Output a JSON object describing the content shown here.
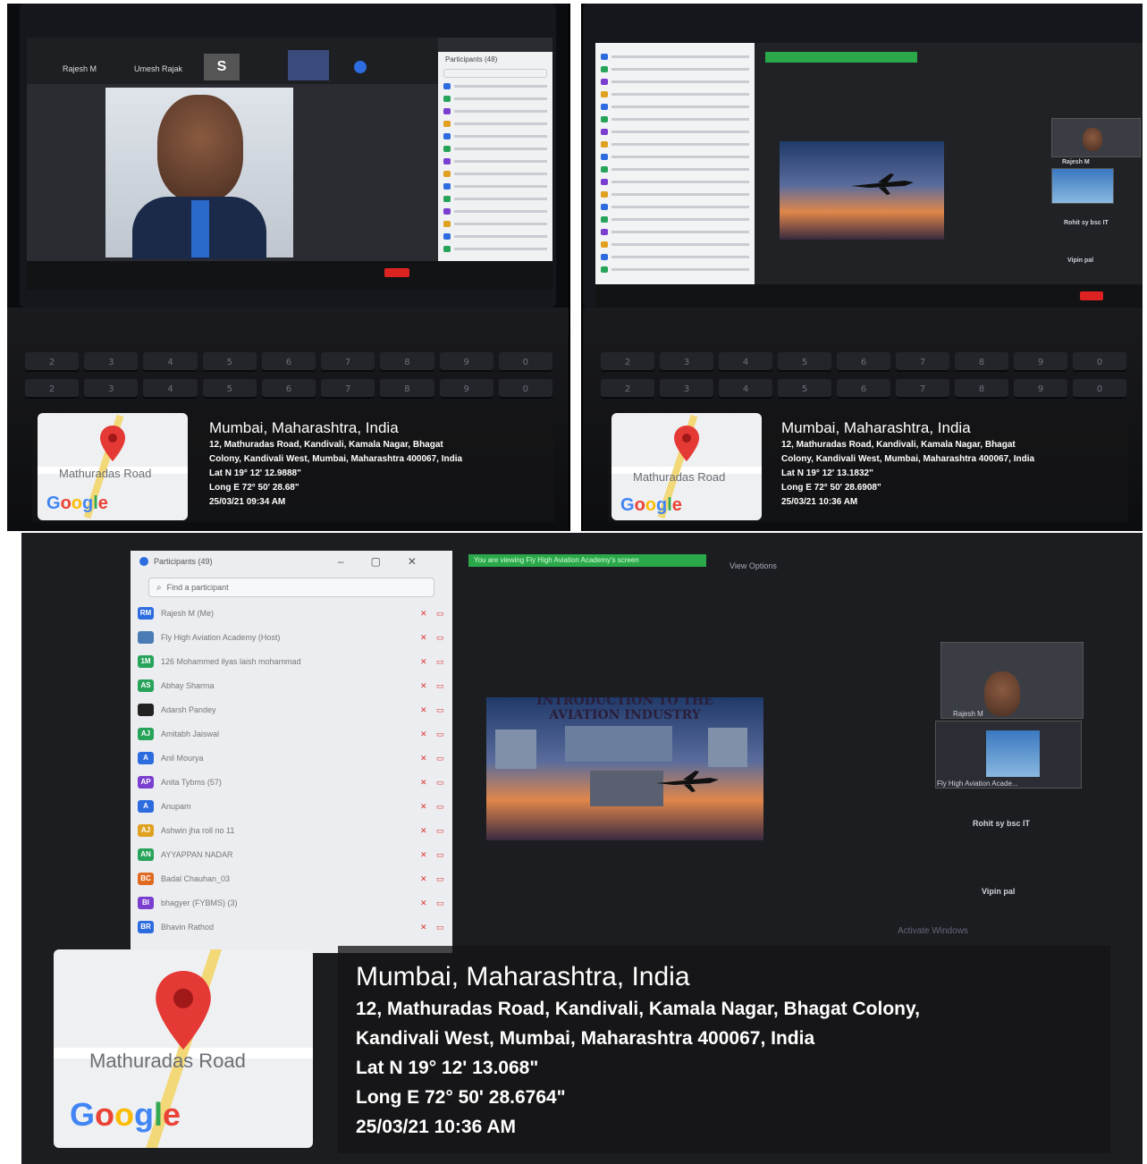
{
  "photos": [
    {
      "zoom": {
        "top_names": [
          "Rajesh M",
          "Umesh Rajak",
          "S"
        ],
        "participants_title": "Participants (48)"
      },
      "stamp": {
        "city": "Mumbai, Maharashtra, India",
        "address_line1": "12, Mathuradas Road, Kandivali, Kamala Nagar, Bhagat",
        "address_line2": "Colony, Kandivali West, Mumbai, Maharashtra 400067, India",
        "lat": "Lat N 19° 12' 12.9888\"",
        "long": "Long E 72° 50' 28.68\"",
        "datetime": "25/03/21 09:34 AM",
        "map_label": "Mathuradas Road",
        "logo": "Google"
      }
    },
    {
      "zoom": {
        "thumb_names": [
          "Rajesh M",
          "Rohit sy bsc IT",
          "Vipin pal"
        ]
      },
      "stamp": {
        "city": "Mumbai, Maharashtra, India",
        "address_line1": "12, Mathuradas Road, Kandivali, Kamala Nagar, Bhagat",
        "address_line2": "Colony, Kandivali West, Mumbai, Maharashtra 400067, India",
        "lat": "Lat N 19° 12' 13.1832\"",
        "long": "Long E 72° 50' 28.6908\"",
        "datetime": "25/03/21 10:36 AM",
        "map_label": "Mathuradas Road",
        "logo": "Google"
      }
    },
    {
      "zoom": {
        "participants_title": "Participants (49)",
        "search_placeholder": "Find a participant",
        "view_options": "View Options",
        "sharing_banner": "You are viewing Fly High Aviation Academy's screen",
        "slide_title_1": "INTRODUCTION TO THE",
        "slide_title_2": "AVIATION INDUSTRY",
        "participants": [
          {
            "initials": "RM",
            "name": "Rajesh M (Me)",
            "color": "#2d6cdf"
          },
          {
            "initials": "",
            "name": "Fly High Aviation Academy (Host)",
            "color": "#4a7bb5"
          },
          {
            "initials": "1M",
            "name": "126 Mohammed ilyas laish mohammad",
            "color": "#27a35a"
          },
          {
            "initials": "AS",
            "name": "Abhay Sharma",
            "color": "#27a35a"
          },
          {
            "initials": "",
            "name": "Adarsh Pandey",
            "color": "#222222"
          },
          {
            "initials": "AJ",
            "name": "Amitabh Jaiswal",
            "color": "#27a35a"
          },
          {
            "initials": "A",
            "name": "Anil Mourya",
            "color": "#2d6cdf"
          },
          {
            "initials": "AP",
            "name": "Anita Tybms (57)",
            "color": "#7b3fd0"
          },
          {
            "initials": "A",
            "name": "Anupam",
            "color": "#2d6cdf"
          },
          {
            "initials": "AJ",
            "name": "Ashwin jha roll no 11",
            "color": "#e0a020"
          },
          {
            "initials": "AN",
            "name": "AYYAPPAN NADAR",
            "color": "#27a35a"
          },
          {
            "initials": "BC",
            "name": "Badal Chauhan_03",
            "color": "#e06a20"
          },
          {
            "initials": "BI",
            "name": "bhagyer (FYBMS) (3)",
            "color": "#7b3fd0"
          },
          {
            "initials": "BR",
            "name": "Bhavin Rathod",
            "color": "#2d6cdf"
          }
        ],
        "thumb_names": [
          "Rajesh M",
          "Fly High Aviation Acade...",
          "Rohit sy bsc IT",
          "Vipin pal"
        ],
        "watermark": "Activate Windows"
      },
      "stamp": {
        "city": "Mumbai, Maharashtra, India",
        "address_line1": "12, Mathuradas Road, Kandivali, Kamala Nagar, Bhagat Colony,",
        "address_line2": "Kandivali West, Mumbai, Maharashtra 400067, India",
        "lat": "Lat N 19° 12' 13.068\"",
        "long": "Long E 72° 50' 28.6764\"",
        "datetime": "25/03/21 10:36 AM",
        "map_label": "Mathuradas Road",
        "logo": "Google"
      }
    }
  ],
  "keyboard_keys": [
    "2",
    "3",
    "4",
    "5",
    "6",
    "7",
    "8",
    "9",
    "0"
  ],
  "colors": {
    "pin": "#e53935",
    "stamp_bg": "#141416",
    "zoom_green": "#2aa84a"
  }
}
